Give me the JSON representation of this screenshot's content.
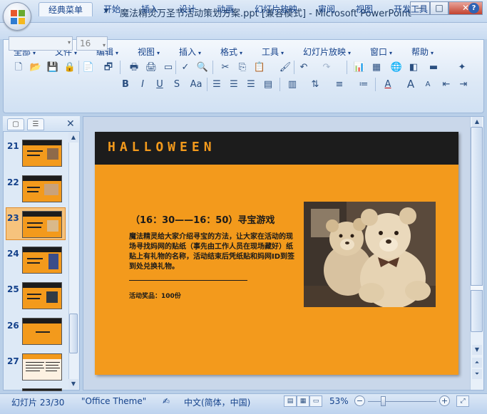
{
  "window": {
    "title": "魔法精灵万圣节活动策划方案.ppt [兼容模式] - Microsoft PowerPoint",
    "minimize": "—",
    "maximize": "□",
    "close": "✕"
  },
  "quick_access": {
    "save": "💾",
    "undo": "↶",
    "redo": "↻",
    "customize": "▾"
  },
  "tabs": [
    "经典菜单",
    "开始",
    "插入",
    "设计",
    "动画",
    "幻灯片放映",
    "审阅",
    "视图",
    "开发工具"
  ],
  "help_icon": "?",
  "menus": [
    "全部",
    "文件",
    "编辑",
    "视图",
    "插入",
    "格式",
    "工具",
    "幻灯片放映",
    "窗口",
    "帮助"
  ],
  "font_size_value": "16",
  "slides": [
    {
      "num": "21"
    },
    {
      "num": "22"
    },
    {
      "num": "23"
    },
    {
      "num": "24"
    },
    {
      "num": "25"
    },
    {
      "num": "26"
    },
    {
      "num": "27"
    }
  ],
  "slide": {
    "brand": "HALLOWEEN",
    "heading": "（16：30——16：50）寻宝游戏",
    "body": "魔法精灵给大家介绍寻宝的方法，让大家在活动的现场寻找妈网的贴纸（事先由工作人员在现场藏好）纸贴上有礼物的名称，活动结束后凭纸贴和妈网ID到签到处兑换礼物。",
    "prize": "活动奖品：100份"
  },
  "status": {
    "slide_info": "幻灯片 23/30",
    "theme": "\"Office Theme\"",
    "language": "中文(简体，中国)",
    "zoom": "53%"
  },
  "colors": {
    "slide_orange": "#f39a1c",
    "slide_header": "#1c1c1c",
    "ribbon_blue": "#dce8f6"
  }
}
